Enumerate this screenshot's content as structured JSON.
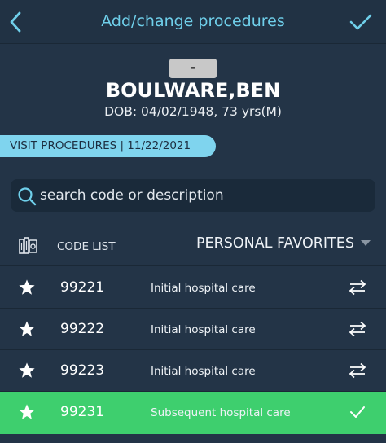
{
  "header": {
    "title": "Add/change procedures",
    "back_icon": "chevron-left-icon",
    "confirm_icon": "checkmark-icon",
    "accent_color": "#6fcfea"
  },
  "patient": {
    "id_badge": "-",
    "name": "BOULWARE,BEN",
    "dob": "DOB: 04/02/1948, 73 yrs(M)"
  },
  "visit": {
    "label": "VISIT PROCEDURES | 11/22/2021",
    "pill_color": "#7fd4ee"
  },
  "search": {
    "placeholder": "search code or description",
    "value": ""
  },
  "list": {
    "code_list_label": "CODE LIST",
    "favorites_label": "PERSONAL FAVORITES",
    "rows": [
      {
        "code": "99221",
        "description": "Initial hospital care",
        "selected": false
      },
      {
        "code": "99222",
        "description": "Initial hospital care",
        "selected": false
      },
      {
        "code": "99223",
        "description": "Initial hospital care",
        "selected": false
      },
      {
        "code": "99231",
        "description": "Subsequent hospital care",
        "selected": true
      }
    ],
    "selected_color": "#3ecf6e"
  }
}
